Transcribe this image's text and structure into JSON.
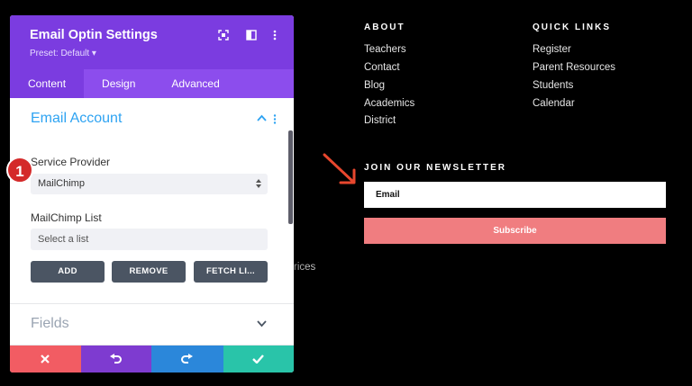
{
  "panel": {
    "title": "Email Optin Settings",
    "preset": "Preset: Default ▾",
    "tabs": [
      {
        "label": "Content",
        "active": true
      },
      {
        "label": "Design",
        "active": false
      },
      {
        "label": "Advanced",
        "active": false
      }
    ],
    "section_email_account": "Email Account",
    "service_provider_label": "Service Provider",
    "service_provider_value": "MailChimp",
    "mailchimp_list_label": "MailChimp List",
    "mailchimp_list_value": "Select a list",
    "buttons": {
      "add": "ADD",
      "remove": "REMOVE",
      "fetch": "FETCH LI..."
    },
    "section_fields": "Fields",
    "step_badge": "1",
    "colors": {
      "header": "#7b3ce0",
      "cancel": "#f25c63",
      "undo": "#7e3bd0",
      "redo": "#2b87da",
      "save": "#29c4a9"
    }
  },
  "site": {
    "about": {
      "heading": "ABOUT",
      "links": [
        "Teachers",
        "Contact",
        "Blog",
        "Academics",
        "District"
      ]
    },
    "quick_links": {
      "heading": "QUICK LINKS",
      "links": [
        "Register",
        "Parent Resources",
        "Students",
        "Calendar"
      ]
    },
    "newsletter": {
      "heading": "JOIN OUR NEWSLETTER",
      "email_placeholder": "Email",
      "subscribe_label": "Subscribe"
    },
    "stray_text": "rices"
  }
}
